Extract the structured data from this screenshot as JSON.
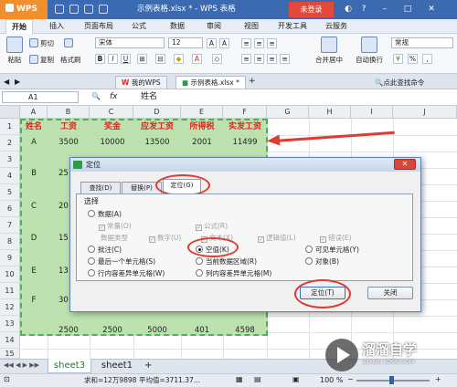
{
  "app": {
    "name": "WPS 表格",
    "doc_title": "示例表格.xlsx * - WPS 表格",
    "login": "未登录"
  },
  "menu": [
    "开始",
    "插入",
    "页面布局",
    "公式",
    "数据",
    "审阅",
    "视图",
    "开发工具",
    "云服务"
  ],
  "ribbon": {
    "paste": "粘贴",
    "cut": "剪切",
    "copy": "复制",
    "format_painter": "格式刷",
    "font": "宋体",
    "size": "12",
    "merge": "合并居中",
    "wrap": "自动换行",
    "number_format": "常规"
  },
  "doc_tabs": [
    "我的WPS",
    "示例表格.xlsx *"
  ],
  "doc_tab_right": "点此查找命令",
  "formula_bar": {
    "cell_ref": "A1",
    "fx": "fx",
    "content": "姓名"
  },
  "columns": [
    "A",
    "B",
    "C",
    "D",
    "E",
    "F",
    "G",
    "H",
    "I",
    "J"
  ],
  "rows": [
    "1",
    "2",
    "3",
    "4",
    "5",
    "6",
    "7",
    "8",
    "9",
    "10",
    "11",
    "12",
    "13",
    "14",
    "15"
  ],
  "table": {
    "header": [
      "姓名",
      "工资",
      "奖金",
      "应发工资",
      "所得税",
      "实发工资"
    ],
    "row2": [
      "A",
      "3500",
      "10000",
      "13500",
      "2001",
      "11499"
    ],
    "row14": [
      "",
      "2500",
      "2500",
      "5000",
      "401",
      "4598"
    ],
    "col_a": [
      "B",
      "C",
      "D",
      "E",
      "F"
    ],
    "col_b_partial": [
      "25",
      "20",
      "15",
      "13",
      "30"
    ]
  },
  "dialog": {
    "title": "定位",
    "tabs": [
      "查找(D)",
      "替换(P)",
      "定位(G)"
    ],
    "group": "选择",
    "opt_data": "数据(A)",
    "sub_constant": "常量(O)",
    "sub_formula": "公式(R)",
    "data_type": "数据类型",
    "type_number": "数字(U)",
    "type_text": "文本(X)",
    "type_logic": "逻辑值(L)",
    "type_error": "错误(E)",
    "opt_comment": "批注(C)",
    "opt_blank": "空值(K)",
    "opt_visible": "可见单元格(Y)",
    "opt_last": "最后一个单元格(S)",
    "opt_region": "当前数据区域(R)",
    "opt_object": "对象(B)",
    "opt_row_diff": "行内容差异单元格(W)",
    "opt_col_diff": "列内容差异单元格(M)",
    "btn_locate": "定位(T)",
    "btn_close": "关闭"
  },
  "sheets": [
    "sheet3",
    "sheet1"
  ],
  "status": {
    "sum": "求和=12万9898",
    "avg": "平均值=3711.37...",
    "zoom": "100 %"
  },
  "watermark": {
    "brand": "溜溜自学",
    "url": "ZIXUE.3D66.COM"
  },
  "colors": {
    "titlebar": "#3c6ab0",
    "selection": "#b5dfa6",
    "header_text": "#d62b20",
    "annotation": "#e0392e"
  }
}
